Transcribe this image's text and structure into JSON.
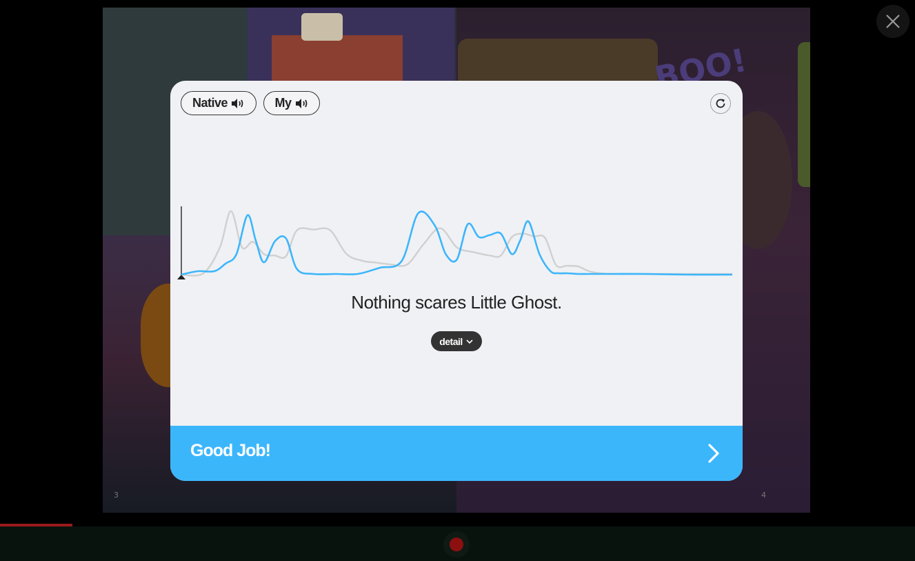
{
  "background": {
    "page_left_number": "3",
    "page_right_number": "4",
    "sign_text": "BOO!"
  },
  "header": {
    "native_label": "Native",
    "my_label": "My"
  },
  "icons": {
    "native_audio": "speaker-icon",
    "my_audio": "speaker-icon",
    "retry": "refresh-icon",
    "close": "close-icon",
    "detail": "chevron-down-icon",
    "next": "chevron-right-icon",
    "record": "record-icon"
  },
  "sentence": "Nothing scares Little Ghost.",
  "detail_label": "detail",
  "result": {
    "label": "Good Job!"
  },
  "colors": {
    "accent": "#3cb6fb",
    "native_wave": "#d0d0d0",
    "user_wave": "#3cb6fb",
    "record": "#8c1010"
  },
  "chart_data": {
    "type": "line",
    "title": "",
    "xlabel": "",
    "ylabel": "",
    "xlim": [
      0,
      100
    ],
    "ylim": [
      0,
      100
    ],
    "series": [
      {
        "x": [
          0,
          4,
          7,
          9,
          11,
          13,
          15,
          17,
          19,
          21,
          24,
          27,
          30,
          33,
          35,
          38,
          41,
          44,
          47,
          50,
          53,
          56,
          58,
          60,
          62,
          64,
          66,
          68,
          70,
          72,
          74,
          76,
          78,
          80,
          82,
          84,
          86,
          88,
          90,
          92,
          94,
          96,
          100
        ],
        "values": [
          0,
          2,
          40,
          93,
          40,
          48,
          30,
          28,
          27,
          65,
          66,
          65,
          30,
          20,
          18,
          15,
          15,
          45,
          68,
          40,
          33,
          28,
          28,
          55,
          60,
          56,
          54,
          14,
          13,
          12,
          5,
          2,
          1,
          1,
          1,
          1,
          1,
          1,
          1,
          1,
          1,
          1,
          1
        ]
      },
      {
        "x": [
          0,
          3,
          6,
          8,
          10,
          12,
          13.5,
          15,
          17,
          19,
          21,
          24,
          28,
          32,
          36,
          40,
          43,
          46,
          48,
          50,
          52,
          54,
          56,
          58,
          60,
          61.5,
          63,
          65,
          67,
          68.5,
          70,
          72,
          74,
          78,
          84,
          92,
          100
        ],
        "values": [
          0,
          5,
          5,
          16,
          30,
          87,
          50,
          18,
          49,
          53,
          8,
          1,
          1,
          1,
          10,
          20,
          90,
          72,
          30,
          22,
          74,
          55,
          58,
          60,
          30,
          50,
          78,
          30,
          5,
          2,
          2,
          1,
          1,
          1,
          1,
          0,
          0
        ]
      }
    ]
  }
}
